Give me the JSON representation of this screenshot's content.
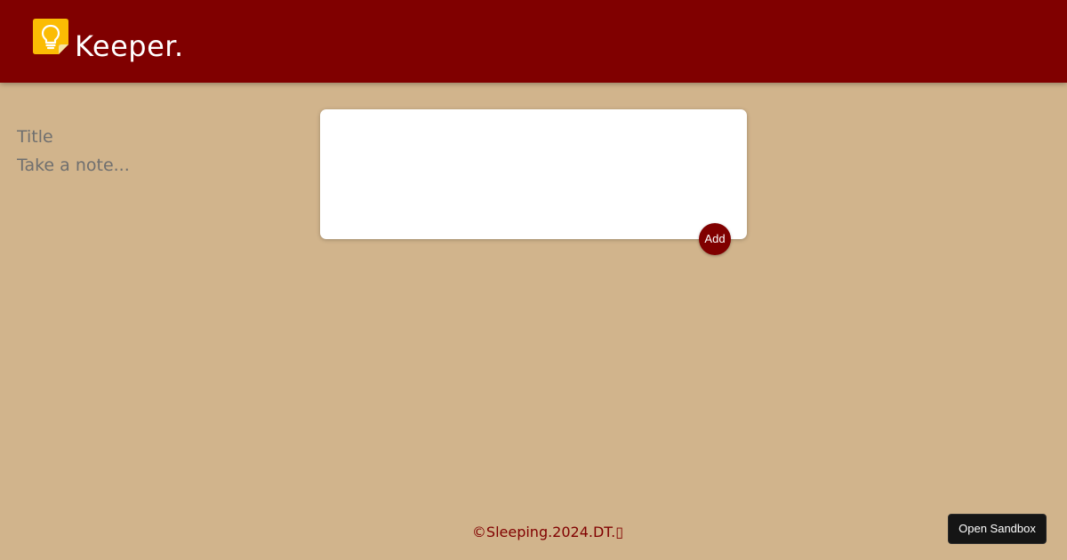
{
  "header": {
    "brand": "Keeper.",
    "logo_icon": "lightbulb-note-icon",
    "background": "#800000",
    "logo_color": "#fbbc04"
  },
  "note_form": {
    "title_placeholder": "Title",
    "content_placeholder": "Take a note...",
    "add_label": "Add"
  },
  "footer": {
    "text": "©Sleeping.2024.DT.▯"
  },
  "sandbox": {
    "button_label": "Open Sandbox"
  },
  "colors": {
    "page_background": "#d1b48c",
    "accent": "#800000"
  }
}
